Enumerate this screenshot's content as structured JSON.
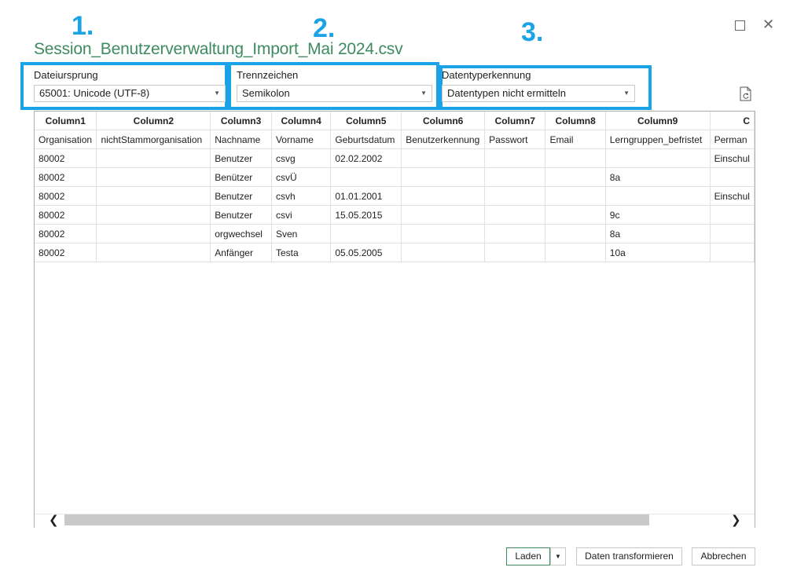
{
  "annotations": {
    "step1": "1.",
    "step2": "2.",
    "step3": "3."
  },
  "dialog": {
    "title": "Session_Benutzerverwaltung_Import_Mai 2024.csv"
  },
  "window_controls": {
    "maximize_icon": "maximize-icon",
    "close_icon": "close-icon",
    "close_glyph": "✕"
  },
  "file_origin": {
    "label": "Dateiursprung",
    "value": "65001: Unicode (UTF-8)"
  },
  "delimiter": {
    "label": "Trennzeichen",
    "value": "Semikolon"
  },
  "datatype": {
    "label": "Datentyperkennung",
    "value": "Datentypen nicht ermitteln"
  },
  "refresh_icon": "document-refresh-icon",
  "caret_glyph": "▼",
  "grid": {
    "columns": [
      "Column1",
      "Column2",
      "Column3",
      "Column4",
      "Column5",
      "Column6",
      "Column7",
      "Column8",
      "Column9",
      "C"
    ],
    "rows": [
      [
        "Organisation",
        "nichtStammorganisation",
        "Nachname",
        "Vorname",
        "Geburtsdatum",
        "Benutzerkennung",
        "Passwort",
        "Email",
        "Lerngruppen_befristet",
        "Perman"
      ],
      [
        "80002",
        "",
        "Benutzer",
        "csvg",
        "02.02.2002",
        "",
        "",
        "",
        "",
        "Einschul"
      ],
      [
        "80002",
        "",
        "Benützer",
        "csvÜ",
        "",
        "",
        "",
        "",
        "8a",
        ""
      ],
      [
        "80002",
        "",
        "Benutzer",
        "csvh",
        "01.01.2001",
        "",
        "",
        "",
        "",
        "Einschul"
      ],
      [
        "80002",
        "",
        "Benutzer",
        "csvi",
        "15.05.2015",
        "",
        "",
        "",
        "9c",
        ""
      ],
      [
        "80002",
        "",
        "orgwechsel",
        "Sven",
        "",
        "",
        "",
        "",
        "8a",
        ""
      ],
      [
        "80002",
        "",
        "Anfänger",
        "Testa",
        "05.05.2005",
        "",
        "",
        "",
        "10a",
        ""
      ]
    ]
  },
  "scrollbar": {
    "left_glyph": "❮",
    "right_glyph": "❯"
  },
  "buttons": {
    "load": "Laden",
    "load_menu_glyph": "▼",
    "transform": "Daten transformieren",
    "cancel": "Abbrechen"
  },
  "colors": {
    "accent_blue": "#1aa3e6",
    "title_green": "#3d8b5f"
  }
}
